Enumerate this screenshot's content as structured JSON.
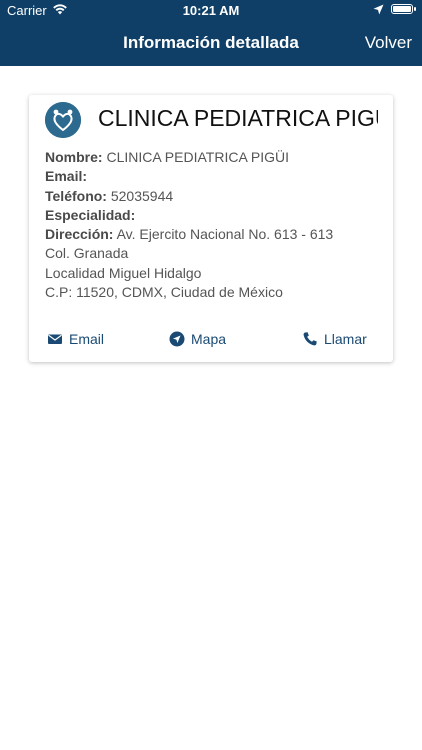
{
  "status": {
    "carrier": "Carrier",
    "time": "10:21 AM"
  },
  "nav": {
    "title": "Información detallada",
    "back_label": "Volver",
    "bar_color": "#0f3f66"
  },
  "card": {
    "title": "CLINICA PEDIATRICA PIGÜI",
    "fields": [
      {
        "label": "Nombre:",
        "value": "CLINICA PEDIATRICA PIGÜI"
      },
      {
        "label": "Email:",
        "value": ""
      },
      {
        "label": "Teléfono:",
        "value": "52035944"
      },
      {
        "label": "Especialidad:",
        "value": ""
      },
      {
        "label": "Dirección:",
        "value": "Av. Ejercito Nacional No. 613 - 613"
      }
    ],
    "address_lines": [
      "Col. Granada",
      "Localidad Miguel Hidalgo",
      "C.P: 11520, CDMX, Ciudad de México"
    ],
    "actions": {
      "email_label": "Email",
      "map_label": "Mapa",
      "call_label": "Llamar"
    },
    "icons": [
      "logo-icon",
      "mail-icon",
      "navigation-icon",
      "phone-icon"
    ]
  }
}
